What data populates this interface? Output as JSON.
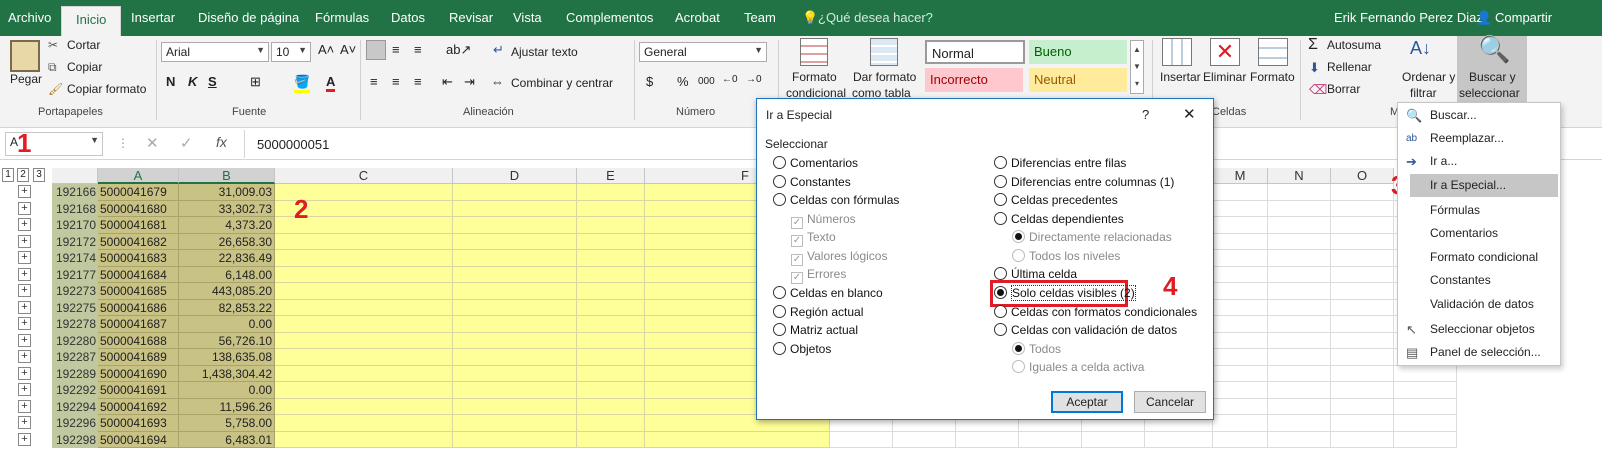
{
  "tabs": [
    "Archivo",
    "Inicio",
    "Insertar",
    "Diseño de página",
    "Fórmulas",
    "Datos",
    "Revisar",
    "Vista",
    "Complementos",
    "Acrobat",
    "Team"
  ],
  "tell_me": "¿Qué desea hacer?",
  "user": "Erik Fernando Perez Diaz",
  "share": "Compartir",
  "clipboard": {
    "paste": "Pegar",
    "cut": "Cortar",
    "copy": "Copiar",
    "format_painter": "Copiar formato",
    "group": "Portapapeles"
  },
  "font": {
    "name": "Arial",
    "size": "10",
    "group": "Fuente",
    "bold": "N",
    "italic": "K",
    "underline": "S"
  },
  "alignment": {
    "wrap": "Ajustar texto",
    "merge": "Combinar y centrar",
    "group": "Alineación"
  },
  "number": {
    "format": "General",
    "currency": "$",
    "percent": "%",
    "thousands": "000",
    "group": "Número"
  },
  "styles": {
    "cond_format_1": "Formato",
    "cond_format_2": "condicional",
    "table_format_1": "Dar formato",
    "table_format_2": "como tabla",
    "normal": "Normal",
    "bueno": "Bueno",
    "incorrecto": "Incorrecto",
    "neutral": "Neutral"
  },
  "cells": {
    "insert": "Insertar",
    "delete": "Eliminar",
    "format": "Formato",
    "group": "Celdas"
  },
  "editing": {
    "autosum": "Autosuma",
    "fill": "Rellenar",
    "clear": "Borrar",
    "sort_1": "Ordenar y",
    "sort_2": "filtrar",
    "find_1": "Buscar y",
    "find_2": "seleccionar",
    "group_letter": "M"
  },
  "formula_bar": {
    "name_box": "A",
    "fx": "fx",
    "value": "5000000051"
  },
  "outline_levels": [
    "1",
    "2",
    "3"
  ],
  "columns": [
    "A",
    "B",
    "C",
    "D",
    "E",
    "F",
    "M",
    "N",
    "O"
  ],
  "rows": [
    {
      "n": "192166",
      "a": "5000041679",
      "b": "31,009.03"
    },
    {
      "n": "192168",
      "a": "5000041680",
      "b": "33,302.73"
    },
    {
      "n": "192170",
      "a": "5000041681",
      "b": "4,373.20"
    },
    {
      "n": "192172",
      "a": "5000041682",
      "b": "26,658.30"
    },
    {
      "n": "192174",
      "a": "5000041683",
      "b": "22,836.49"
    },
    {
      "n": "192177",
      "a": "5000041684",
      "b": "6,148.00"
    },
    {
      "n": "192273",
      "a": "5000041685",
      "b": "443,085.20"
    },
    {
      "n": "192275",
      "a": "5000041686",
      "b": "82,853.22"
    },
    {
      "n": "192278",
      "a": "5000041687",
      "b": "0.00"
    },
    {
      "n": "192280",
      "a": "5000041688",
      "b": "56,726.10"
    },
    {
      "n": "192287",
      "a": "5000041689",
      "b": "138,635.08"
    },
    {
      "n": "192289",
      "a": "5000041690",
      "b": "1,438,304.42"
    },
    {
      "n": "192292",
      "a": "5000041691",
      "b": "0.00"
    },
    {
      "n": "192294",
      "a": "5000041692",
      "b": "11,596.26"
    },
    {
      "n": "192296",
      "a": "5000041693",
      "b": "5,758.00"
    },
    {
      "n": "192298",
      "a": "5000041694",
      "b": "6,483.01"
    }
  ],
  "annotations": [
    "1",
    "2",
    "3",
    "4"
  ],
  "dialog": {
    "title": "Ir a Especial",
    "help": "?",
    "close": "✕",
    "section": "Seleccionar",
    "left_options": [
      "Comentarios",
      "Constantes",
      "Celdas con fórmulas"
    ],
    "formula_subs": [
      "Números",
      "Texto",
      "Valores lógicos",
      "Errores"
    ],
    "left_options_2": [
      "Celdas en blanco",
      "Región actual",
      "Matriz actual",
      "Objetos"
    ],
    "right_options": [
      "Diferencias entre filas",
      "Diferencias entre columnas (1)",
      "Celdas precedentes",
      "Celdas dependientes"
    ],
    "dep_subs": [
      "Directamente relacionadas",
      "Todos los niveles"
    ],
    "right_options_2": [
      "Última celda",
      "Solo celdas visibles (2)",
      "Celdas con formatos condicionales",
      "Celdas con validación de datos"
    ],
    "val_subs": [
      "Todos",
      "Iguales a celda activa"
    ],
    "ok": "Aceptar",
    "cancel": "Cancelar"
  },
  "menu": {
    "items": [
      "Buscar...",
      "Reemplazar...",
      "Ir a...",
      "Ir a Especial...",
      "Fórmulas",
      "Comentarios",
      "Formato condicional",
      "Constantes",
      "Validación de datos",
      "Seleccionar objetos",
      "Panel de selección..."
    ]
  }
}
